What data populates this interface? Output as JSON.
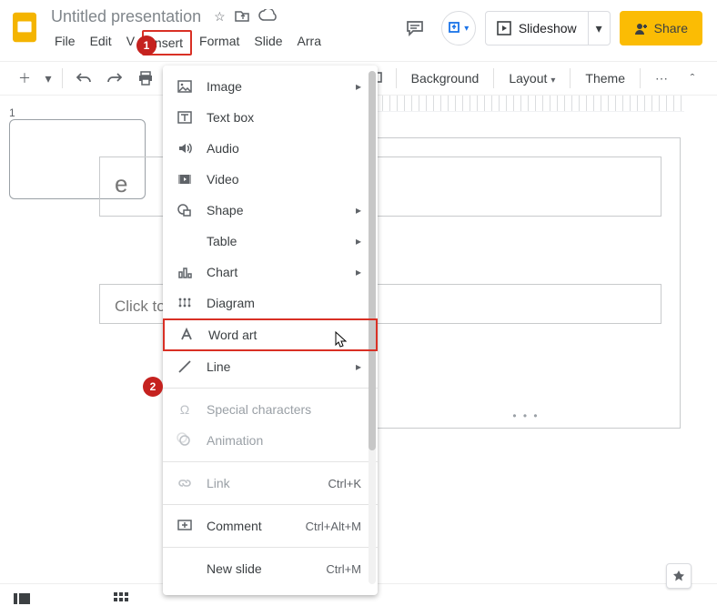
{
  "header": {
    "doc_title": "Untitled presentation",
    "menus": [
      "File",
      "Edit",
      "V",
      "Insert",
      "Format",
      "Slide",
      "Arra"
    ],
    "slideshow_label": "Slideshow",
    "share_label": "Share"
  },
  "toolbar": {
    "background": "Background",
    "layout": "Layout",
    "theme": "Theme"
  },
  "sidebar": {
    "slide_number": "1"
  },
  "slide": {
    "title_placeholder": "e",
    "subtitle_placeholder": "Click to add subtitle"
  },
  "insert_menu": {
    "image": "Image",
    "textbox": "Text box",
    "audio": "Audio",
    "video": "Video",
    "shape": "Shape",
    "table": "Table",
    "chart": "Chart",
    "diagram": "Diagram",
    "wordart": "Word art",
    "line": "Line",
    "special": "Special characters",
    "animation": "Animation",
    "link": "Link",
    "link_short": "Ctrl+K",
    "comment": "Comment",
    "comment_short": "Ctrl+Alt+M",
    "newslide": "New slide",
    "newslide_short": "Ctrl+M"
  },
  "annotations": {
    "step1": "1",
    "step2": "2"
  }
}
